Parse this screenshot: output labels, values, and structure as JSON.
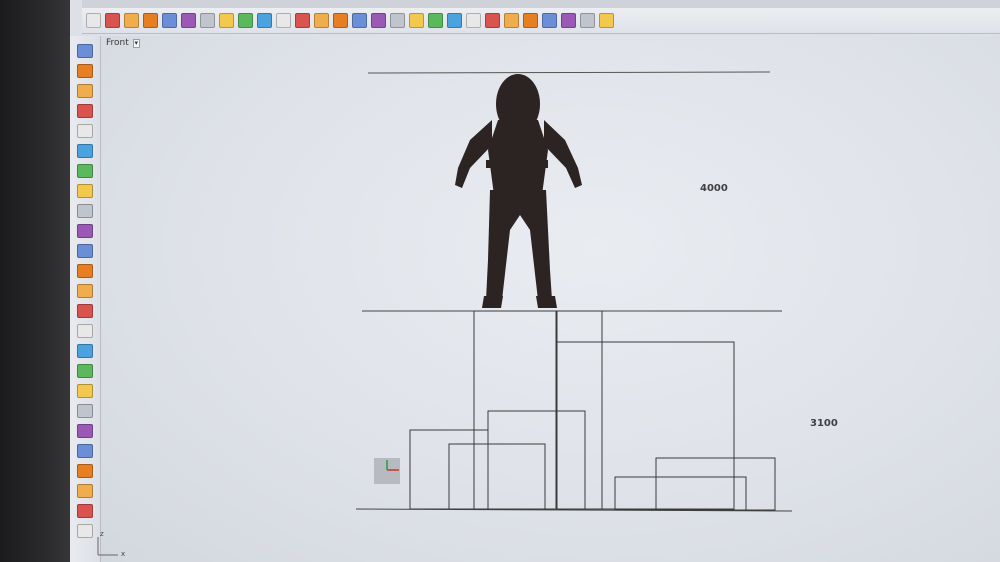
{
  "viewport": {
    "name": "Front"
  },
  "dimensions": {
    "upper": "4000",
    "lower": "3100"
  },
  "axes": {
    "x": "x",
    "z": "z"
  },
  "toolbar_icons": [
    "new-icon",
    "open-icon",
    "save-icon",
    "print-icon",
    "import-icon",
    "export-icon",
    "cut-icon",
    "copy-icon",
    "paste-icon",
    "undo-icon",
    "redo-icon",
    "pan-icon",
    "rotate-view-icon",
    "zoom-icon",
    "zoom-window-icon",
    "zoom-extents-icon",
    "select-icon",
    "layers-icon",
    "properties-icon",
    "render-icon",
    "grid-icon",
    "object-snap-icon",
    "block-icon",
    "display-mode-icon",
    "save-small-icon",
    "save-as-icon",
    "open-folder-icon",
    "help-icon"
  ],
  "left_tools": [
    "select-arrow-icon",
    "point-icon",
    "polyline-icon",
    "curve-icon",
    "circle-icon",
    "arc-icon",
    "ellipse-icon",
    "rectangle-icon",
    "polygon-icon",
    "text-curve-icon",
    "fillet-icon",
    "surface-icon",
    "extrude-icon",
    "box-icon",
    "sphere-icon",
    "mesh-icon",
    "transform-icon",
    "boolean-icon",
    "explode-icon",
    "join-icon",
    "group-icon",
    "analyze-icon",
    "render-tool-icon",
    "dimension-icon",
    "text-tool-icon"
  ]
}
